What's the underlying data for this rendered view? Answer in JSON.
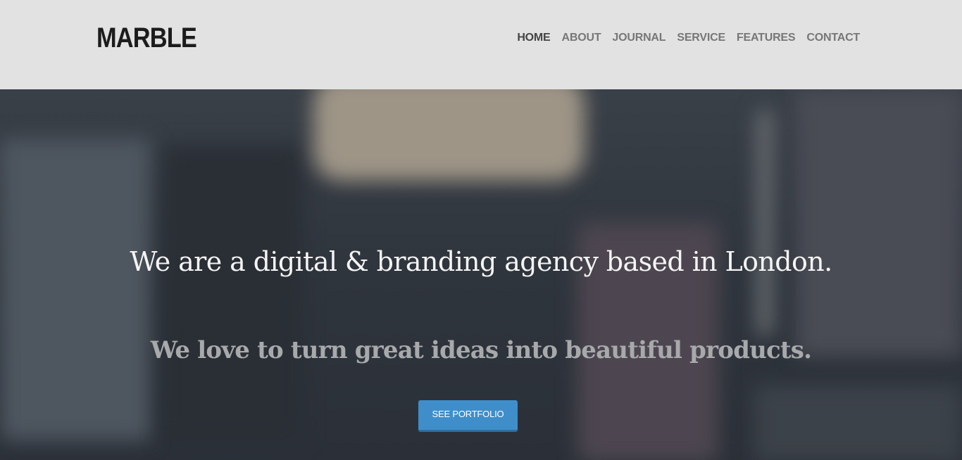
{
  "header": {
    "logo": "MARBLE",
    "nav": [
      {
        "label": "HOME",
        "active": true
      },
      {
        "label": "ABOUT",
        "active": false
      },
      {
        "label": "JOURNAL",
        "active": false
      },
      {
        "label": "SERVICE",
        "active": false
      },
      {
        "label": "FEATURES",
        "active": false
      },
      {
        "label": "CONTACT",
        "active": false
      }
    ]
  },
  "hero": {
    "headline": "We are a digital & branding agency based in London.",
    "subline": "We love to turn great ideas into beautiful products.",
    "cta_label": "SEE PORTFOLIO"
  },
  "colors": {
    "header_bg": "#e2e2e2",
    "accent": "#3f8ec9",
    "hero_bg": "#2e343c"
  }
}
